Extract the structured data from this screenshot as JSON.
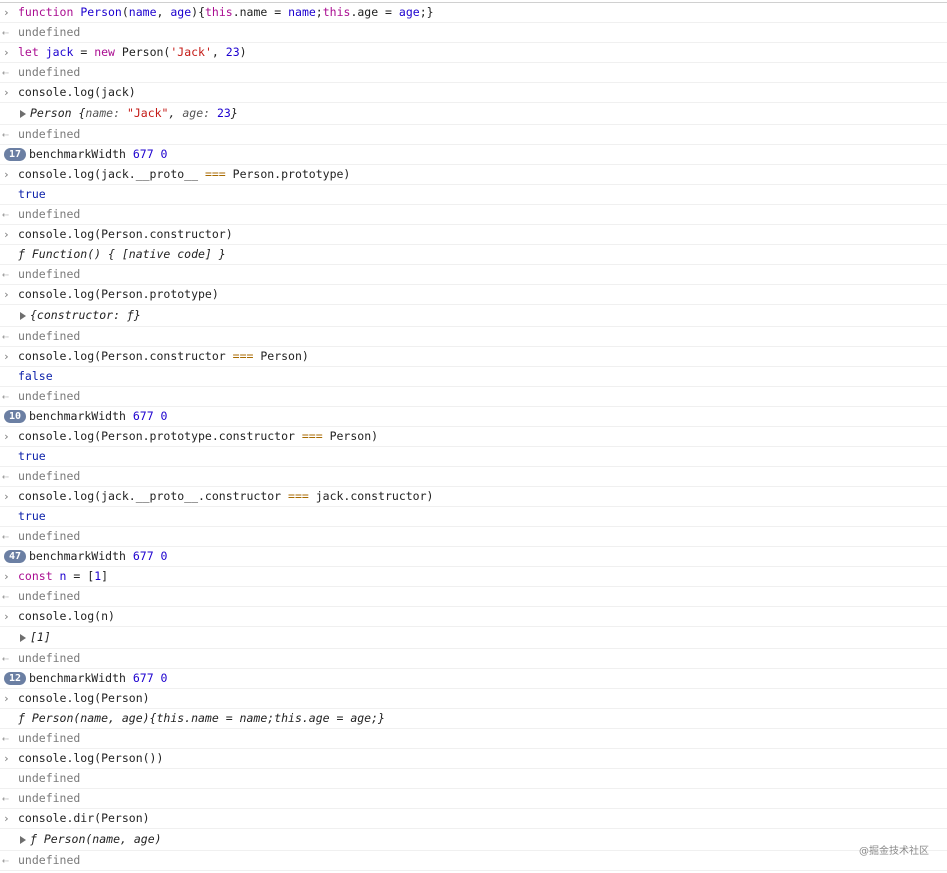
{
  "watermark": "@掘金技术社区",
  "rows": [
    {
      "kind": "input",
      "segments": [
        {
          "t": "function ",
          "c": "kw"
        },
        {
          "t": "Person",
          "c": "fn"
        },
        {
          "t": "(",
          "c": ""
        },
        {
          "t": "name",
          "c": "fn"
        },
        {
          "t": ", ",
          "c": ""
        },
        {
          "t": "age",
          "c": "fn"
        },
        {
          "t": "){",
          "c": ""
        },
        {
          "t": "this",
          "c": "kw"
        },
        {
          "t": ".name = ",
          "c": ""
        },
        {
          "t": "name",
          "c": "fn"
        },
        {
          "t": ";",
          "c": ""
        },
        {
          "t": "this",
          "c": "kw"
        },
        {
          "t": ".age = ",
          "c": ""
        },
        {
          "t": "age",
          "c": "fn"
        },
        {
          "t": ";}",
          "c": ""
        }
      ]
    },
    {
      "kind": "return",
      "segments": [
        {
          "t": "undefined",
          "c": "undef"
        }
      ]
    },
    {
      "kind": "input",
      "segments": [
        {
          "t": "let ",
          "c": "kw"
        },
        {
          "t": "jack",
          "c": "fn"
        },
        {
          "t": " = ",
          "c": ""
        },
        {
          "t": "new ",
          "c": "kw"
        },
        {
          "t": "Person(",
          "c": ""
        },
        {
          "t": "'Jack'",
          "c": "str"
        },
        {
          "t": ", ",
          "c": ""
        },
        {
          "t": "23",
          "c": "num"
        },
        {
          "t": ")",
          "c": ""
        }
      ]
    },
    {
      "kind": "return",
      "segments": [
        {
          "t": "undefined",
          "c": "undef"
        }
      ]
    },
    {
      "kind": "input",
      "segments": [
        {
          "t": "console.log(jack)",
          "c": ""
        }
      ]
    },
    {
      "kind": "object",
      "tall": true,
      "segments": [
        {
          "t": "Person {",
          "c": "ital"
        },
        {
          "t": "name: ",
          "c": "prop"
        },
        {
          "t": "\"Jack\"",
          "c": "str"
        },
        {
          "t": ", ",
          "c": "ital"
        },
        {
          "t": "age: ",
          "c": "prop"
        },
        {
          "t": "23",
          "c": "num"
        },
        {
          "t": "}",
          "c": "ital"
        }
      ]
    },
    {
      "kind": "return",
      "segments": [
        {
          "t": "undefined",
          "c": "undef"
        }
      ]
    },
    {
      "kind": "badge",
      "badge": "17",
      "segments": [
        {
          "t": "benchmarkWidth ",
          "c": ""
        },
        {
          "t": "677 0",
          "c": "num"
        }
      ]
    },
    {
      "kind": "input",
      "segments": [
        {
          "t": "console.log(jack.__proto__ ",
          "c": ""
        },
        {
          "t": "===",
          "c": "op"
        },
        {
          "t": " Person.prototype)",
          "c": ""
        }
      ]
    },
    {
      "kind": "output",
      "segments": [
        {
          "t": "true",
          "c": "bool"
        }
      ]
    },
    {
      "kind": "return",
      "segments": [
        {
          "t": "undefined",
          "c": "undef"
        }
      ]
    },
    {
      "kind": "input",
      "segments": [
        {
          "t": "console.log(Person.constructor)",
          "c": ""
        }
      ]
    },
    {
      "kind": "output",
      "segments": [
        {
          "t": "ƒ Function() { [native code] }",
          "c": "ital"
        }
      ]
    },
    {
      "kind": "return",
      "segments": [
        {
          "t": "undefined",
          "c": "undef"
        }
      ]
    },
    {
      "kind": "input",
      "segments": [
        {
          "t": "console.log(Person.prototype)",
          "c": ""
        }
      ]
    },
    {
      "kind": "object",
      "tall": true,
      "segments": [
        {
          "t": "{constructor: ƒ}",
          "c": "ital"
        }
      ]
    },
    {
      "kind": "return",
      "segments": [
        {
          "t": "undefined",
          "c": "undef"
        }
      ]
    },
    {
      "kind": "input",
      "segments": [
        {
          "t": "console.log(Person.constructor ",
          "c": ""
        },
        {
          "t": "===",
          "c": "op"
        },
        {
          "t": " Person)",
          "c": ""
        }
      ]
    },
    {
      "kind": "output",
      "segments": [
        {
          "t": "false",
          "c": "bool"
        }
      ]
    },
    {
      "kind": "return",
      "segments": [
        {
          "t": "undefined",
          "c": "undef"
        }
      ]
    },
    {
      "kind": "badge",
      "badge": "10",
      "segments": [
        {
          "t": "benchmarkWidth ",
          "c": ""
        },
        {
          "t": "677 0",
          "c": "num"
        }
      ]
    },
    {
      "kind": "input",
      "segments": [
        {
          "t": "console.log(Person.prototype.constructor ",
          "c": ""
        },
        {
          "t": "===",
          "c": "op"
        },
        {
          "t": " Person)",
          "c": ""
        }
      ]
    },
    {
      "kind": "output",
      "segments": [
        {
          "t": "true",
          "c": "bool"
        }
      ]
    },
    {
      "kind": "return",
      "segments": [
        {
          "t": "undefined",
          "c": "undef"
        }
      ]
    },
    {
      "kind": "input",
      "segments": [
        {
          "t": "console.log(jack.__proto__.constructor ",
          "c": ""
        },
        {
          "t": "===",
          "c": "op"
        },
        {
          "t": " jack.constructor)",
          "c": ""
        }
      ]
    },
    {
      "kind": "output",
      "segments": [
        {
          "t": "true",
          "c": "bool"
        }
      ]
    },
    {
      "kind": "return",
      "segments": [
        {
          "t": "undefined",
          "c": "undef"
        }
      ]
    },
    {
      "kind": "badge",
      "badge": "47",
      "segments": [
        {
          "t": "benchmarkWidth ",
          "c": ""
        },
        {
          "t": "677 0",
          "c": "num"
        }
      ]
    },
    {
      "kind": "input",
      "segments": [
        {
          "t": "const ",
          "c": "kw"
        },
        {
          "t": "n",
          "c": "fn"
        },
        {
          "t": " = [",
          "c": ""
        },
        {
          "t": "1",
          "c": "num"
        },
        {
          "t": "]",
          "c": ""
        }
      ]
    },
    {
      "kind": "return",
      "segments": [
        {
          "t": "undefined",
          "c": "undef"
        }
      ]
    },
    {
      "kind": "input",
      "segments": [
        {
          "t": "console.log(n)",
          "c": ""
        }
      ]
    },
    {
      "kind": "object",
      "tall": true,
      "segments": [
        {
          "t": "[1]",
          "c": "ital"
        }
      ]
    },
    {
      "kind": "return",
      "segments": [
        {
          "t": "undefined",
          "c": "undef"
        }
      ]
    },
    {
      "kind": "badge",
      "badge": "12",
      "segments": [
        {
          "t": "benchmarkWidth ",
          "c": ""
        },
        {
          "t": "677 0",
          "c": "num"
        }
      ]
    },
    {
      "kind": "input",
      "segments": [
        {
          "t": "console.log(Person)",
          "c": ""
        }
      ]
    },
    {
      "kind": "output",
      "segments": [
        {
          "t": "ƒ Person(name, age){this.name = name;this.age = age;}",
          "c": "ital"
        }
      ]
    },
    {
      "kind": "return",
      "segments": [
        {
          "t": "undefined",
          "c": "undef"
        }
      ]
    },
    {
      "kind": "input",
      "segments": [
        {
          "t": "console.log(Person())",
          "c": ""
        }
      ]
    },
    {
      "kind": "output",
      "segments": [
        {
          "t": "undefined",
          "c": "undef"
        }
      ]
    },
    {
      "kind": "return",
      "segments": [
        {
          "t": "undefined",
          "c": "undef"
        }
      ]
    },
    {
      "kind": "input",
      "segments": [
        {
          "t": "console.dir(Person)",
          "c": ""
        }
      ]
    },
    {
      "kind": "object",
      "tall": true,
      "segments": [
        {
          "t": "ƒ Person(name, age)",
          "c": "ital"
        }
      ]
    },
    {
      "kind": "return",
      "segments": [
        {
          "t": "undefined",
          "c": "undef"
        }
      ]
    }
  ]
}
